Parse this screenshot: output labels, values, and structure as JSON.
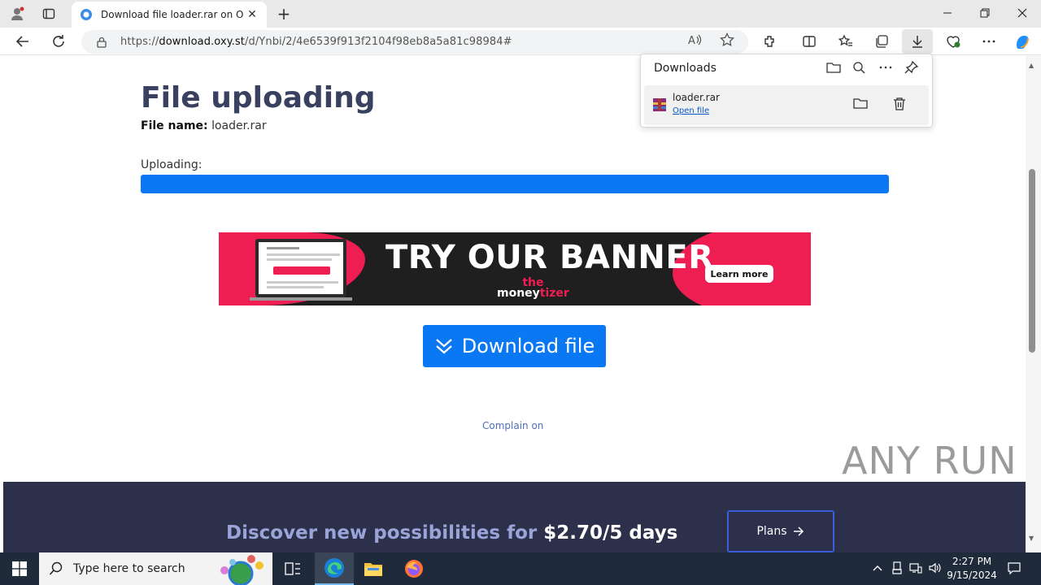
{
  "browser": {
    "tab_title": "Download file loader.rar on Oxy.Cloud",
    "tab_close": "✕",
    "new_tab": "+",
    "url_prefix": "https://",
    "url_host": "download.oxy.st",
    "url_path": "/d/Ynbi/2/4e6539f913f2104f98eb8a5a81c98984#"
  },
  "downloads_panel": {
    "title": "Downloads",
    "item": {
      "filename": "loader.rar",
      "action": "Open file"
    }
  },
  "page": {
    "heading": "File uploading",
    "file_name_label": "File name:",
    "file_name_value": "loader.rar",
    "uploading_label": "Uploading:",
    "progress_fraction": 1.0,
    "banner": {
      "headline": "TRY OUR BANNER",
      "brand_top": "the",
      "brand_main": "money",
      "brand_accent": "tizer",
      "cta": "Learn more"
    },
    "download_button": "Download file",
    "complain_link": "Complain on",
    "footer": {
      "promo_text": "Discover new possibilities for ",
      "promo_price": "$2.70/5 days",
      "plans_button": "Plans"
    }
  },
  "watermark": "ANY RUN",
  "taskbar": {
    "search_placeholder": "Type here to search",
    "time": "2:27 PM",
    "date": "9/15/2024"
  },
  "colors": {
    "accent_blue": "#0a78f2",
    "heading": "#3a4060",
    "footer_bg": "#2c304a",
    "banner_pink": "#ee1e52"
  }
}
